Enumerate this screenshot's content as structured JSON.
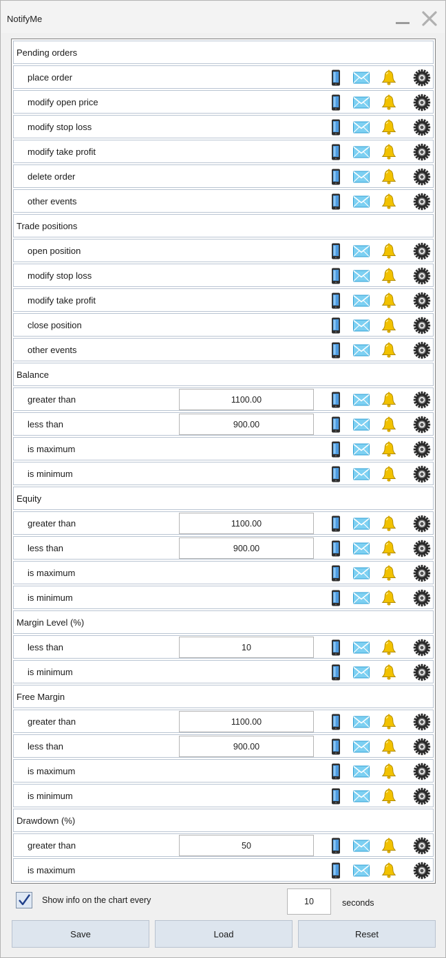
{
  "window": {
    "title": "NotifyMe"
  },
  "rows": [
    {
      "type": "section",
      "label": "Pending orders"
    },
    {
      "type": "item",
      "label": "place order"
    },
    {
      "type": "item",
      "label": "modify open price"
    },
    {
      "type": "item",
      "label": "modify stop loss"
    },
    {
      "type": "item",
      "label": "modify take profit"
    },
    {
      "type": "item",
      "label": "delete order"
    },
    {
      "type": "item",
      "label": "other events"
    },
    {
      "type": "section",
      "label": "Trade positions"
    },
    {
      "type": "item",
      "label": "open position"
    },
    {
      "type": "item",
      "label": "modify stop loss"
    },
    {
      "type": "item",
      "label": "modify take profit"
    },
    {
      "type": "item",
      "label": "close position"
    },
    {
      "type": "item",
      "label": "other events"
    },
    {
      "type": "section",
      "label": "Balance"
    },
    {
      "type": "item",
      "label": "greater than",
      "value": "1100.00"
    },
    {
      "type": "item",
      "label": "less than",
      "value": "900.00"
    },
    {
      "type": "item",
      "label": "is maximum"
    },
    {
      "type": "item",
      "label": "is minimum"
    },
    {
      "type": "section",
      "label": "Equity"
    },
    {
      "type": "item",
      "label": "greater than",
      "value": "1100.00"
    },
    {
      "type": "item",
      "label": "less than",
      "value": "900.00"
    },
    {
      "type": "item",
      "label": "is maximum"
    },
    {
      "type": "item",
      "label": "is minimum"
    },
    {
      "type": "section",
      "label": "Margin Level (%)"
    },
    {
      "type": "item",
      "label": "less than",
      "value": "10"
    },
    {
      "type": "item",
      "label": "is minimum"
    },
    {
      "type": "section",
      "label": "Free Margin"
    },
    {
      "type": "item",
      "label": "greater than",
      "value": "1100.00"
    },
    {
      "type": "item",
      "label": "less than",
      "value": "900.00"
    },
    {
      "type": "item",
      "label": "is maximum"
    },
    {
      "type": "item",
      "label": "is minimum"
    },
    {
      "type": "section",
      "label": "Drawdown (%)"
    },
    {
      "type": "item",
      "label": "greater than",
      "value": "50"
    },
    {
      "type": "item",
      "label": "is maximum"
    }
  ],
  "icons": {
    "phone": "phone-icon",
    "mail": "mail-icon",
    "bell": "bell-icon",
    "gear": "gear-icon"
  },
  "footer": {
    "show_info_checked": true,
    "show_info_label": "Show info on the chart every",
    "interval_value": "10",
    "seconds_label": "seconds"
  },
  "buttons": {
    "save": "Save",
    "load": "Load",
    "reset": "Reset"
  },
  "colors": {
    "row_border": "#b9c4d2",
    "button_bg": "#dde5ee",
    "mail_blue": "#5bc0eb",
    "bell_gold": "#f2c200"
  }
}
